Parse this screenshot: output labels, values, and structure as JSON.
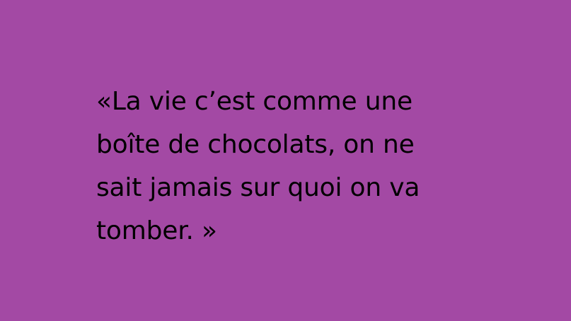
{
  "background_color": "#a349a4",
  "text_color": "#000000",
  "quote": {
    "lines": [
      "«La vie c’est comme une",
      "boîte de chocolats, on ne",
      "sait jamais sur quoi on va",
      "tomber. »"
    ]
  }
}
